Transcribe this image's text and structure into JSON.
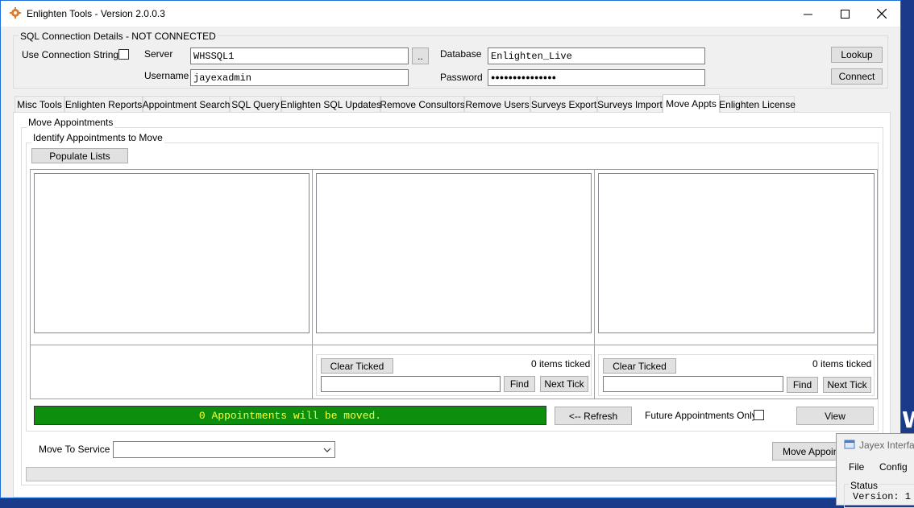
{
  "window": {
    "title": "Enlighten Tools - Version 2.0.0.3"
  },
  "connection": {
    "group_title": "SQL Connection Details - NOT CONNECTED",
    "use_conn_string_label": "Use Connection String?",
    "server_label": "Server",
    "server_value": "WHSSQL1",
    "browse_label": "..",
    "username_label": "Username",
    "username_value": "jayexadmin",
    "database_label": "Database",
    "database_value": "Enlighten_Live",
    "password_label": "Password",
    "password_value": "●●●●●●●●●●●●●●●",
    "lookup_label": "Lookup",
    "connect_label": "Connect"
  },
  "tabs": [
    {
      "label": "Misc Tools"
    },
    {
      "label": "Enlighten Reports"
    },
    {
      "label": "Appointment Search"
    },
    {
      "label": "SQL Query"
    },
    {
      "label": "Enlighten SQL Updates"
    },
    {
      "label": "Remove Consultors"
    },
    {
      "label": "Remove Users"
    },
    {
      "label": "Surveys Export"
    },
    {
      "label": "Surveys Import"
    },
    {
      "label": "Move Appts"
    },
    {
      "label": "Enlighten License"
    }
  ],
  "move": {
    "group_title": "Move Appointments",
    "identify_title": "Identify Appointments to Move",
    "populate_label": "Populate Lists",
    "clear_ticked_label": "Clear Ticked",
    "items_ticked_1": "0 items ticked",
    "items_ticked_2": "0 items ticked",
    "find_label": "Find",
    "next_tick_label": "Next Tick",
    "status_text": "0 Appointments will be moved.",
    "refresh_label": "<-- Refresh",
    "future_only_label": "Future Appointments Only?",
    "view_label": "View",
    "move_to_service_label": "Move To Service",
    "move_appts_label": "Move Appointments"
  },
  "popup": {
    "title": "Jayex Interface",
    "menu_file": "File",
    "menu_config": "Config",
    "status_label": "Status",
    "version_text": "Version: 1"
  },
  "background_text": "W",
  "colors": {
    "status_bg": "#0d8f0d",
    "status_fg": "#ffff33",
    "desktop": "#1a3a8a"
  }
}
